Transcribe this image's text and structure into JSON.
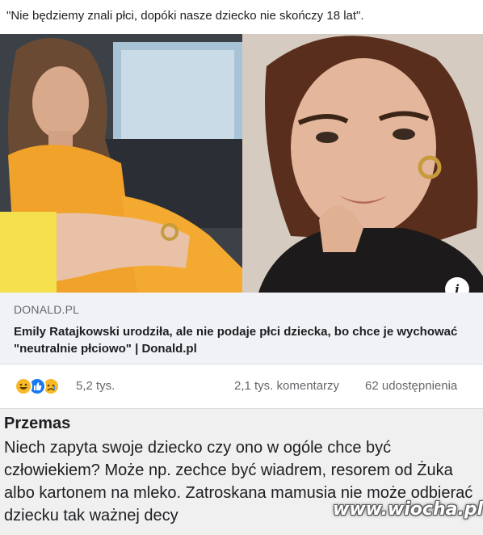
{
  "post": {
    "text": "\"Nie będziemy znali płci, dopóki nasze dziecko nie skończy 18 lat\"."
  },
  "link_preview": {
    "domain": "DONALD.PL",
    "title": "Emily Ratajkowski urodziła, ale nie podaje płci dziecka, bo chce je wychować \"neutralnie płciowo\" | Donald.pl",
    "info_icon": "i"
  },
  "engagement": {
    "reactions": [
      "haha",
      "like",
      "sad"
    ],
    "reaction_count": "5,2 tys.",
    "comments": "2,1 tys. komentarzy",
    "shares": "62 udostępnienia"
  },
  "comment": {
    "author": "Przemas",
    "body": "Niech zapyta swoje dziecko czy ono w ogóle chce być człowiekiem? Może np. zechce być wiadrem, resorem od Żuka albo kartonem na mleko. Zatroskana mamusia nie może odbierać dziecku tak ważnej decy"
  },
  "watermark": "www.wiocha.pl",
  "colors": {
    "meta_text": "#65676b",
    "link_card_bg": "#f0f2f5",
    "like_blue": "#1877f2",
    "haha_yellow": "#f7b928"
  }
}
